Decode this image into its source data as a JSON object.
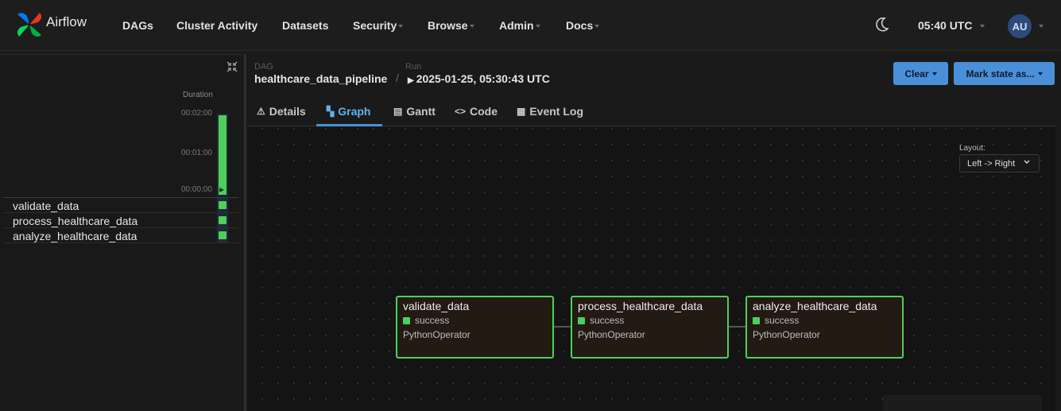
{
  "navbar": {
    "brand": "Airflow",
    "items": [
      "DAGs",
      "Cluster Activity",
      "Datasets",
      "Security",
      "Browse",
      "Admin",
      "Docs"
    ],
    "time": "05:40 UTC",
    "avatar_initials": "AU",
    "theme_icon": "moon-icon"
  },
  "grid": {
    "duration_label": "Duration",
    "ticks": [
      "00:02:00",
      "00:01:00",
      "00:00:00"
    ],
    "tasks": [
      "validate_data",
      "process_healthcare_data",
      "analyze_healthcare_data"
    ],
    "status_color": "#4cd05a"
  },
  "breadcrumb": {
    "dag_label": "DAG",
    "dag_id": "healthcare_data_pipeline",
    "sep": "/",
    "run_label": "Run",
    "run_id": "2025-01-25, 05:30:43 UTC"
  },
  "actions": {
    "clear": "Clear",
    "mark_state": "Mark state as..."
  },
  "tabs": {
    "details": "Details",
    "graph": "Graph",
    "gantt": "Gantt",
    "code": "Code",
    "event_log": "Event Log",
    "active": "Graph"
  },
  "layout": {
    "label": "Layout:",
    "value": "Left -> Right"
  },
  "nodes": [
    {
      "name": "validate_data",
      "status": "success",
      "operator": "PythonOperator"
    },
    {
      "name": "process_healthcare_data",
      "status": "success",
      "operator": "PythonOperator"
    },
    {
      "name": "analyze_healthcare_data",
      "status": "success",
      "operator": "PythonOperator"
    }
  ],
  "colors": {
    "accent": "#4a90d9",
    "success": "#4cd05a"
  }
}
